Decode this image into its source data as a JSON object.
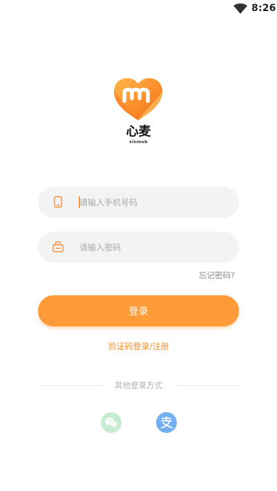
{
  "status_bar": {
    "time": "8:26",
    "wifi_icon": "wifi-icon"
  },
  "brand": {
    "name": "心麦",
    "subtitle": "xinmob",
    "logo_icon": "heart-m-logo-icon",
    "accent_color": "#fd9b38"
  },
  "form": {
    "phone_placeholder": "请输入手机号码",
    "phone_icon": "phone-icon",
    "password_placeholder": "请输入密码",
    "password_icon": "lock-icon",
    "forgot_label": "忘记密码?",
    "login_label": "登录",
    "code_login_label": "验证码登录/注册"
  },
  "other_login": {
    "label": "其他登录方式",
    "items": [
      {
        "icon": "wechat-icon",
        "color": "#c8eccf"
      },
      {
        "icon": "alipay-icon",
        "color": "#72aef0"
      }
    ]
  }
}
